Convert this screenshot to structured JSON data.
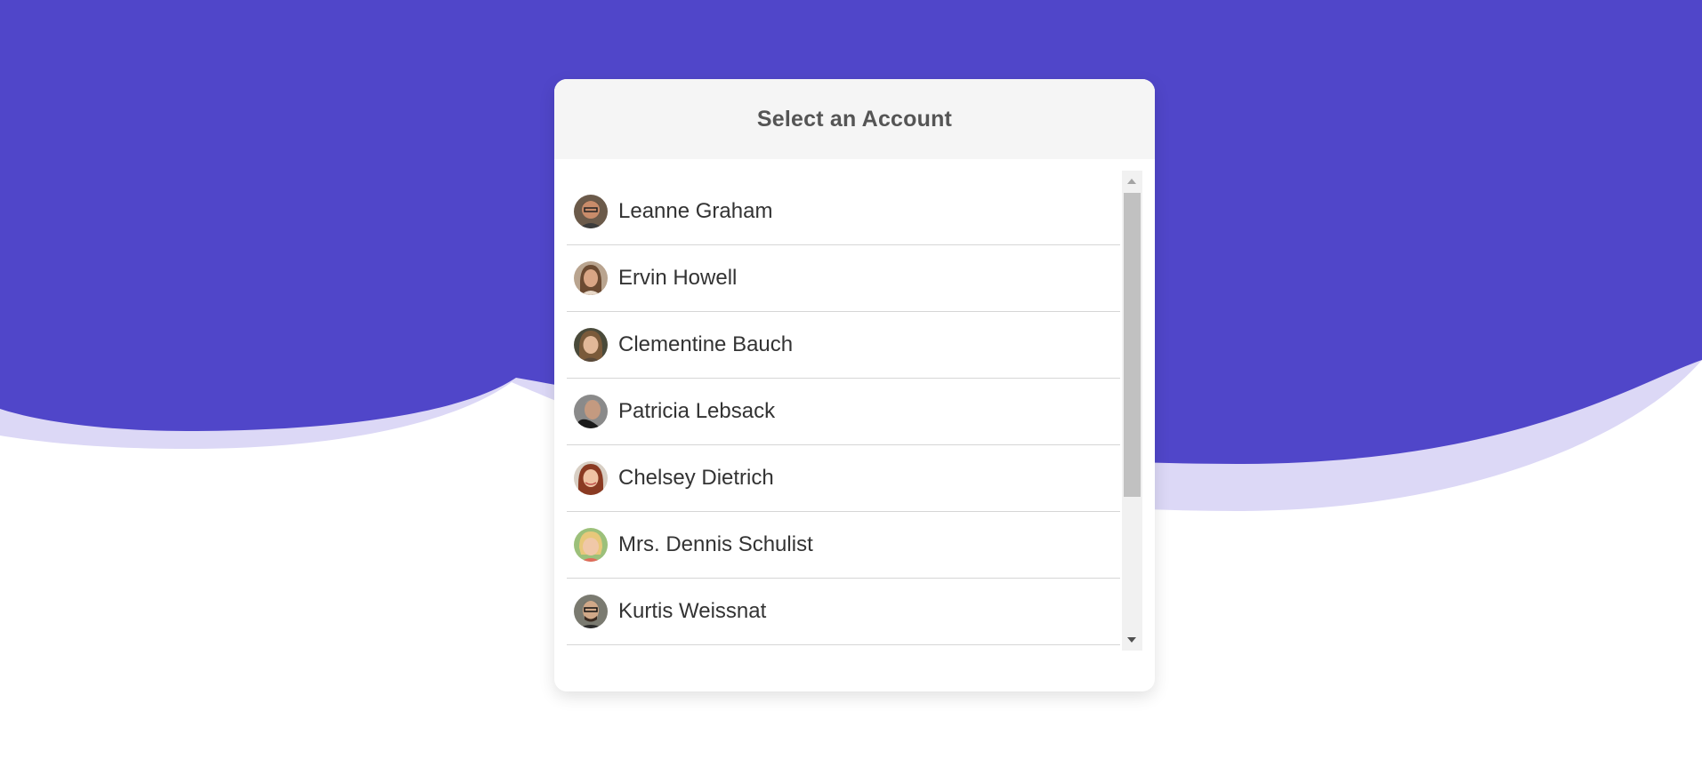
{
  "colors": {
    "wave_primary": "#5046c9",
    "wave_shadow": "#dcd8f6",
    "header_bg": "#f5f5f5",
    "title_text": "#555555"
  },
  "dialog": {
    "title": "Select an Account"
  },
  "accounts": [
    {
      "name": "Leanne Graham",
      "avatar": "male-portrait-avatar"
    },
    {
      "name": "Ervin Howell",
      "avatar": "female-portrait-avatar"
    },
    {
      "name": "Clementine Bauch",
      "avatar": "female-portrait-avatar"
    },
    {
      "name": "Patricia Lebsack",
      "avatar": "male-portrait-avatar"
    },
    {
      "name": "Chelsey Dietrich",
      "avatar": "female-portrait-avatar"
    },
    {
      "name": "Mrs. Dennis Schulist",
      "avatar": "child-portrait-avatar"
    },
    {
      "name": "Kurtis Weissnat",
      "avatar": "male-portrait-avatar"
    }
  ]
}
